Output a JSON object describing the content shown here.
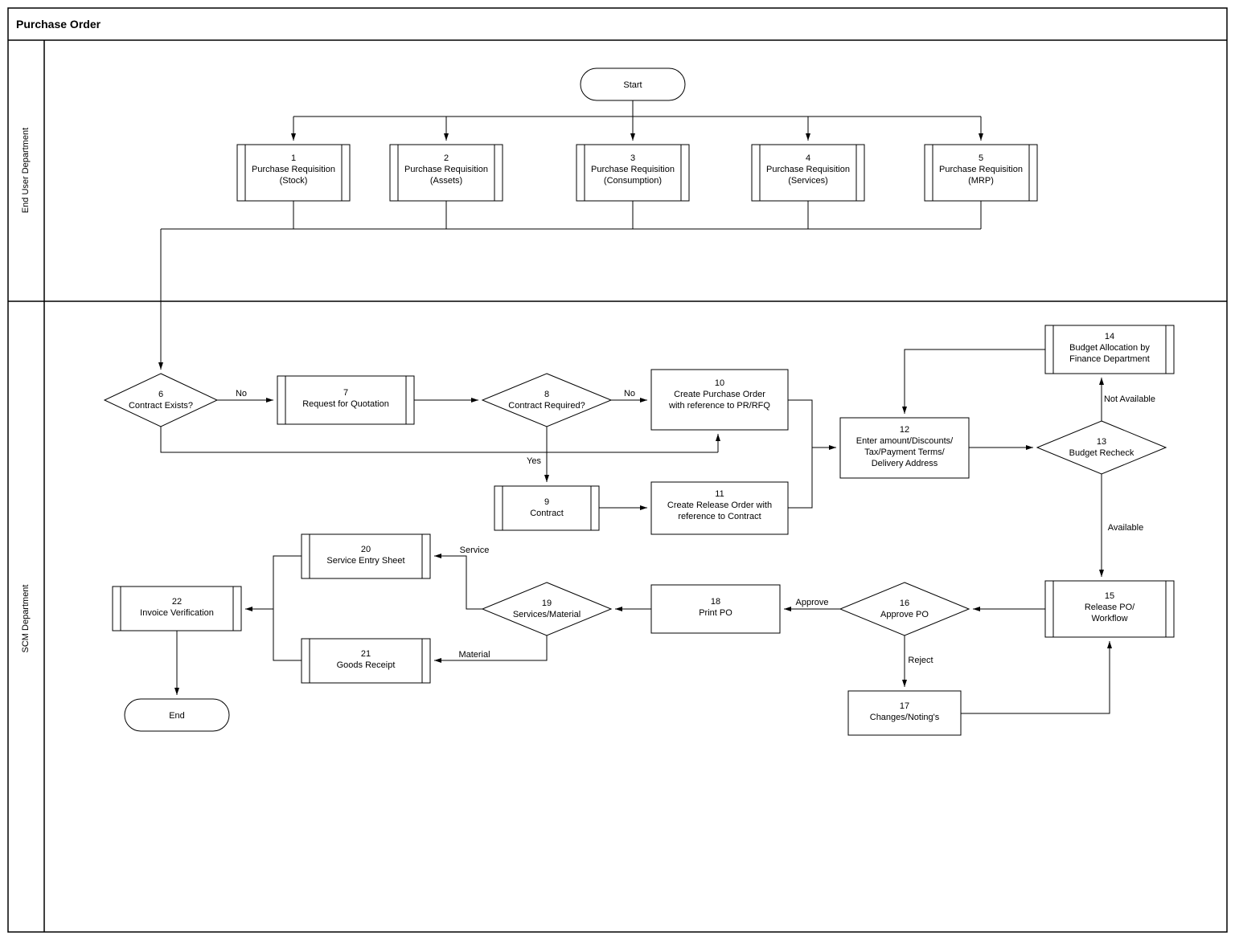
{
  "title": "Purchase Order",
  "lanes": {
    "top": "End User Department",
    "bottom": "SCM Department"
  },
  "start": "Start",
  "end": "End",
  "nodes": {
    "n1": {
      "num": "1",
      "line1": "Purchase Requisition",
      "line2": "(Stock)"
    },
    "n2": {
      "num": "2",
      "line1": "Purchase Requisition",
      "line2": "(Assets)"
    },
    "n3": {
      "num": "3",
      "line1": "Purchase Requisition",
      "line2": "(Consumption)"
    },
    "n4": {
      "num": "4",
      "line1": "Purchase Requisition",
      "line2": "(Services)"
    },
    "n5": {
      "num": "5",
      "line1": "Purchase Requisition",
      "line2": "(MRP)"
    },
    "n6": {
      "num": "6",
      "line1": "Contract Exists?"
    },
    "n7": {
      "num": "7",
      "line1": "Request for Quotation"
    },
    "n8": {
      "num": "8",
      "line1": "Contract Required?"
    },
    "n9": {
      "num": "9",
      "line1": "Contract"
    },
    "n10": {
      "num": "10",
      "line1": "Create Purchase Order",
      "line2": "with reference to PR/RFQ"
    },
    "n11": {
      "num": "11",
      "line1": "Create Release Order with",
      "line2": "reference to Contract"
    },
    "n12": {
      "num": "12",
      "line1": "Enter amount/Discounts/",
      "line2": "Tax/Payment Terms/",
      "line3": "Delivery Address"
    },
    "n13": {
      "num": "13",
      "line1": "Budget Recheck"
    },
    "n14": {
      "num": "14",
      "line1": "Budget Allocation by",
      "line2": "Finance Department"
    },
    "n15": {
      "num": "15",
      "line1": "Release PO/",
      "line2": "Workflow"
    },
    "n16": {
      "num": "16",
      "line1": "Approve PO"
    },
    "n17": {
      "num": "17",
      "line1": "Changes/Noting's"
    },
    "n18": {
      "num": "18",
      "line1": "Print PO"
    },
    "n19": {
      "num": "19",
      "line1": "Services/Material"
    },
    "n20": {
      "num": "20",
      "line1": "Service Entry Sheet"
    },
    "n21": {
      "num": "21",
      "line1": "Goods Receipt"
    },
    "n22": {
      "num": "22",
      "line1": "Invoice Verification"
    }
  },
  "edges": {
    "no1": "No",
    "no2": "No",
    "yes": "Yes",
    "notavail": "Not Available",
    "avail": "Available",
    "approve": "Approve",
    "reject": "Reject",
    "service": "Service",
    "material": "Material"
  }
}
